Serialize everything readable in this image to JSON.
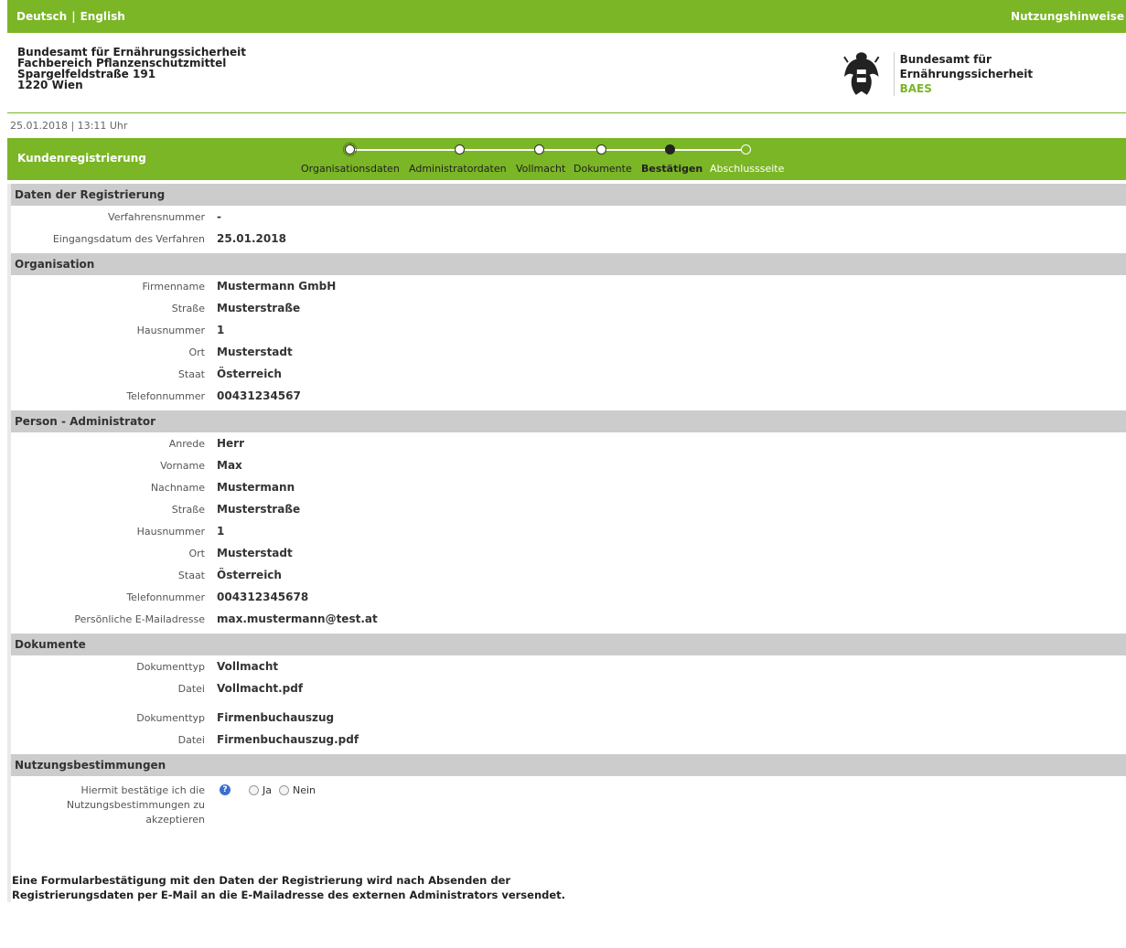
{
  "topbar": {
    "lang_de": "Deutsch",
    "lang_sep": "|",
    "lang_en": "English",
    "help": "Nutzungshinweise"
  },
  "agency": {
    "address": [
      "Bundesamt für Ernährungssicherheit",
      "Fachbereich Pflanzenschutzmittel",
      "Spargelfeldstraße 191",
      "1220 Wien"
    ],
    "brand_name": "Bundesamt für Ernährungssicherheit",
    "brand_abbr": "BAES"
  },
  "datetime": "25.01.2018 | 13:11 Uhr",
  "wizard": {
    "title": "Kundenregistrierung",
    "steps": [
      "Organisationsdaten",
      "Administratordaten",
      "Vollmacht",
      "Dokumente",
      "Bestätigen",
      "Abschlussseite"
    ],
    "active_step": 4
  },
  "sections": {
    "registration": {
      "title": "Daten der Registrierung",
      "rows": [
        {
          "label": "Verfahrensnummer",
          "value": "-"
        },
        {
          "label": "Eingangsdatum des Verfahren",
          "value": "25.01.2018"
        }
      ]
    },
    "organisation": {
      "title": "Organisation",
      "rows": [
        {
          "label": "Firmenname",
          "value": "Mustermann GmbH"
        },
        {
          "label": "Straße",
          "value": "Musterstraße"
        },
        {
          "label": "Hausnummer",
          "value": "1"
        },
        {
          "label": "Ort",
          "value": "Musterstadt"
        },
        {
          "label": "Staat",
          "value": "Österreich"
        },
        {
          "label": "Telefonnummer",
          "value": "00431234567"
        }
      ]
    },
    "admin": {
      "title": "Person - Administrator",
      "rows": [
        {
          "label": "Anrede",
          "value": "Herr"
        },
        {
          "label": "Vorname",
          "value": "Max"
        },
        {
          "label": "Nachname",
          "value": "Mustermann"
        },
        {
          "label": "Straße",
          "value": "Musterstraße"
        },
        {
          "label": "Hausnummer",
          "value": "1"
        },
        {
          "label": "Ort",
          "value": "Musterstadt"
        },
        {
          "label": "Staat",
          "value": "Österreich"
        },
        {
          "label": "Telefonnummer",
          "value": "004312345678"
        },
        {
          "label": "Persönliche E-Mailadresse",
          "value": "max.mustermann@test.at"
        }
      ]
    },
    "documents": {
      "title": "Dokumente",
      "groups": [
        [
          {
            "label": "Dokumenttyp",
            "value": "Vollmacht"
          },
          {
            "label": "Datei",
            "value": "Vollmacht.pdf"
          }
        ],
        [
          {
            "label": "Dokumenttyp",
            "value": "Firmenbuchauszug"
          },
          {
            "label": "Datei",
            "value": "Firmenbuchauszug.pdf"
          }
        ]
      ]
    },
    "terms": {
      "title": "Nutzungsbestimmungen",
      "label_lines": [
        "Hiermit bestätige ich die",
        "Nutzungsbestimmungen zu",
        "akzeptieren"
      ],
      "info_glyph": "?",
      "option_yes": "Ja",
      "option_no": "Nein"
    }
  },
  "note_lines": [
    "Eine Formularbestätigung mit den Daten der Registrierung wird nach Absenden der",
    "Registrierungsdaten per E-Mail an die E-Mailadresse des externen Administrators versendet."
  ],
  "colors": {
    "brand_green": "#7ab625",
    "section_gray": "#cccccc",
    "info_blue": "#3a6fd0"
  }
}
